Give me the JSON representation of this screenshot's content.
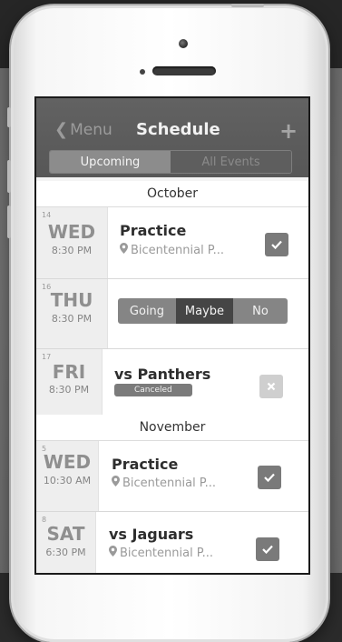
{
  "nav": {
    "back_label": "Menu",
    "title": "Schedule",
    "add_icon": "plus-icon"
  },
  "segment": {
    "items": [
      {
        "label": "Upcoming",
        "selected": true
      },
      {
        "label": "All Events",
        "selected": false
      }
    ]
  },
  "months": [
    {
      "name": "October",
      "events": [
        {
          "date_num": "14",
          "day": "WED",
          "time": "8:30 PM",
          "title": "Practice",
          "location": "Bicentennial P...",
          "status": "checked"
        },
        {
          "date_num": "16",
          "day": "THU",
          "time": "8:30 PM",
          "rsvp": [
            "Going",
            "Maybe",
            "No"
          ],
          "rsvp_selected": "Maybe"
        },
        {
          "date_num": "17",
          "day": "FRI",
          "time": "8:30 PM",
          "title": "vs Panthers",
          "badge": "Canceled",
          "status": "dismiss"
        }
      ]
    },
    {
      "name": "November",
      "events": [
        {
          "date_num": "5",
          "day": "WED",
          "time": "10:30 AM",
          "title": "Practice",
          "location": "Bicentennial P...",
          "status": "checked"
        },
        {
          "date_num": "8",
          "day": "SAT",
          "time": "6:30 PM",
          "title": "vs Jaguars",
          "location": "Bicentennial P...",
          "status": "checked"
        }
      ]
    }
  ],
  "colors": {
    "nav_bg": "#5b5b5b",
    "accent_dark": "#444444",
    "check_bg": "#7a7a7a"
  }
}
